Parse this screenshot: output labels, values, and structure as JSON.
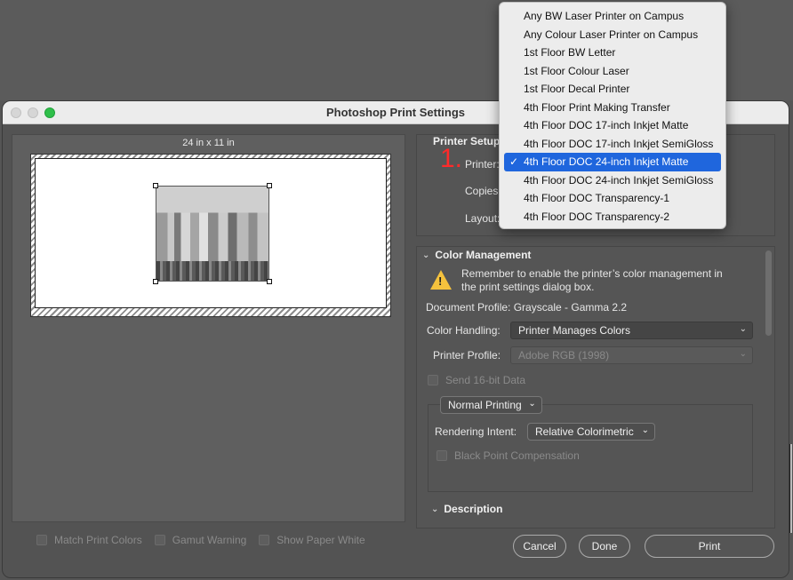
{
  "window": {
    "title": "Photoshop Print Settings"
  },
  "preview": {
    "paper_size": "24 in x 11 in"
  },
  "options": [
    {
      "label": "Match Print Colors"
    },
    {
      "label": "Gamut Warning"
    },
    {
      "label": "Show Paper White"
    }
  ],
  "printer_setup": {
    "title": "Printer Setup",
    "printer_label": "Printer:",
    "copies_label": "Copies:",
    "layout_label": "Layout:",
    "annotation": "1."
  },
  "printer_menu": {
    "items": [
      "Any BW Laser Printer on Campus",
      "Any Colour Laser Printer on Campus",
      "1st Floor BW Letter",
      "1st Floor Colour Laser",
      "1st Floor Decal Printer",
      "4th Floor Print Making Transfer",
      "4th Floor DOC 17-inch Inkjet Matte",
      "4th Floor DOC 17-inch Inkjet SemiGloss",
      "4th Floor DOC 24-inch Inkjet Matte",
      "4th Floor DOC 24-inch Inkjet SemiGloss",
      "4th Floor DOC Transparency-1",
      "4th Floor DOC Transparency-2"
    ],
    "selected_index": 8,
    "check_mark": "✓"
  },
  "color_management": {
    "title": "Color Management",
    "warning": "Remember to enable the printer’s color management in the print settings dialog box.",
    "document_profile": "Document Profile: Grayscale - Gamma 2.2",
    "color_handling_label": "Color Handling:",
    "color_handling_value": "Printer Manages Colors",
    "printer_profile_label": "Printer Profile:",
    "printer_profile_value": "Adobe RGB (1998)",
    "send_16bit_label": "Send 16-bit Data",
    "normal_printing": "Normal Printing",
    "rendering_intent_label": "Rendering Intent:",
    "rendering_intent_value": "Relative Colorimetric",
    "black_point_label": "Black Point Compensation"
  },
  "description": {
    "title": "Description"
  },
  "buttons": {
    "cancel": "Cancel",
    "done": "Done",
    "print": "Print"
  },
  "colors": {
    "accent": "#1f66dd",
    "warning": "#f5c23d",
    "annotation": "#ff2a2a"
  }
}
